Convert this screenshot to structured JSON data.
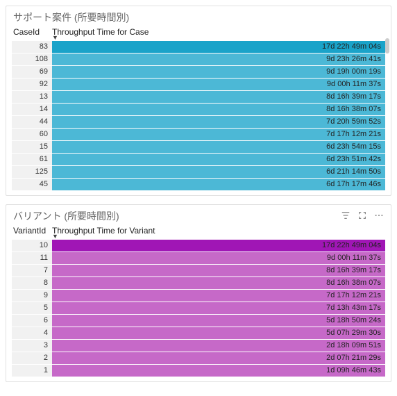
{
  "panels": [
    {
      "title": "サポート案件 (所要時間別)",
      "idHeader": "CaseId",
      "metricHeader": "Throughput Time for Case",
      "barColor": "#4cb8d6",
      "topBarColor": "#1aa3c9",
      "showIcons": false,
      "showScrollHint": true,
      "rows": [
        {
          "id": "83",
          "label": "17d 22h 49m 04s",
          "pct": 100
        },
        {
          "id": "108",
          "label": "9d 23h 26m 41s",
          "pct": 100
        },
        {
          "id": "69",
          "label": "9d 19h 00m 19s",
          "pct": 100
        },
        {
          "id": "92",
          "label": "9d 00h 11m 37s",
          "pct": 100
        },
        {
          "id": "13",
          "label": "8d 16h 39m 17s",
          "pct": 100
        },
        {
          "id": "14",
          "label": "8d 16h 38m 07s",
          "pct": 100
        },
        {
          "id": "44",
          "label": "7d 20h 59m 52s",
          "pct": 100
        },
        {
          "id": "60",
          "label": "7d 17h 12m 21s",
          "pct": 100
        },
        {
          "id": "15",
          "label": "6d 23h 54m 15s",
          "pct": 100
        },
        {
          "id": "61",
          "label": "6d 23h 51m 42s",
          "pct": 100
        },
        {
          "id": "125",
          "label": "6d 21h 14m 50s",
          "pct": 100
        },
        {
          "id": "45",
          "label": "6d 17h 17m 46s",
          "pct": 100
        }
      ]
    },
    {
      "title": "バリアント (所要時間別)",
      "idHeader": "VariantId",
      "metricHeader": "Throughput Time for Variant",
      "barColor": "#c669c8",
      "topBarColor": "#a016b5",
      "showIcons": true,
      "showScrollHint": false,
      "rows": [
        {
          "id": "10",
          "label": "17d 22h 49m 04s",
          "pct": 100
        },
        {
          "id": "11",
          "label": "9d 00h 11m 37s",
          "pct": 100
        },
        {
          "id": "7",
          "label": "8d 16h 39m 17s",
          "pct": 100
        },
        {
          "id": "8",
          "label": "8d 16h 38m 07s",
          "pct": 100
        },
        {
          "id": "9",
          "label": "7d 17h 12m 21s",
          "pct": 100
        },
        {
          "id": "5",
          "label": "7d 13h 43m 17s",
          "pct": 100
        },
        {
          "id": "6",
          "label": "5d 18h 50m 24s",
          "pct": 100
        },
        {
          "id": "4",
          "label": "5d 07h 29m 30s",
          "pct": 100
        },
        {
          "id": "3",
          "label": "2d 18h 09m 51s",
          "pct": 100
        },
        {
          "id": "2",
          "label": "2d 07h 21m 29s",
          "pct": 100
        },
        {
          "id": "1",
          "label": "1d 09h 46m 43s",
          "pct": 100
        }
      ]
    }
  ],
  "chart_data": [
    {
      "type": "bar",
      "title": "サポート案件 (所要時間別)",
      "xlabel": "Throughput Time for Case",
      "ylabel": "CaseId",
      "categories": [
        "83",
        "108",
        "69",
        "92",
        "13",
        "14",
        "44",
        "60",
        "15",
        "61",
        "125",
        "45"
      ],
      "values_label": [
        "17d 22h 49m 04s",
        "9d 23h 26m 41s",
        "9d 19h 00m 19s",
        "9d 00h 11m 37s",
        "8d 16h 39m 17s",
        "8d 16h 38m 07s",
        "7d 20h 59m 52s",
        "7d 17h 12m 21s",
        "6d 23h 54m 15s",
        "6d 23h 51m 42s",
        "6d 21h 14m 50s",
        "6d 17h 17m 46s"
      ],
      "values_seconds": [
        1550944,
        862001,
        846019,
        778297,
        750017,
        749887,
        683992,
        670341,
        604455,
        604302,
        594890,
        580666
      ]
    },
    {
      "type": "bar",
      "title": "バリアント (所要時間別)",
      "xlabel": "Throughput Time for Variant",
      "ylabel": "VariantId",
      "categories": [
        "10",
        "11",
        "7",
        "8",
        "9",
        "5",
        "6",
        "4",
        "3",
        "2",
        "1"
      ],
      "values_label": [
        "17d 22h 49m 04s",
        "9d 00h 11m 37s",
        "8d 16h 39m 17s",
        "8d 16h 38m 07s",
        "7d 17h 12m 21s",
        "7d 13h 43m 17s",
        "5d 18h 50m 24s",
        "5d 07h 29m 30s",
        "2d 18h 09m 51s",
        "2d 07h 21m 29s",
        "1d 09h 46m 43s"
      ],
      "values_seconds": [
        1550944,
        778297,
        750017,
        749887,
        670341,
        657797,
        499824,
        458970,
        238191,
        199289,
        121603
      ]
    }
  ]
}
